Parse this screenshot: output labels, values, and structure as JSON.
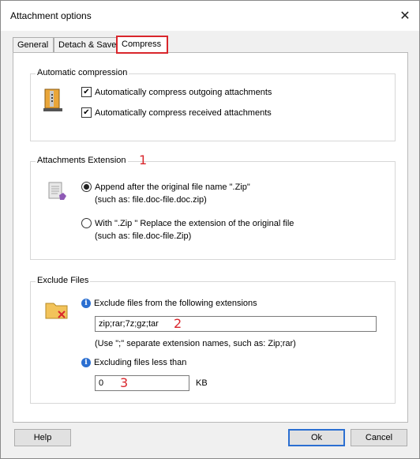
{
  "window": {
    "title": "Attachment options"
  },
  "tabs": [
    {
      "label": "General"
    },
    {
      "label": "Detach & Save"
    },
    {
      "label": "Compress"
    }
  ],
  "auto_compression": {
    "title": "Automatic compression",
    "outgoing_label": "Automatically compress outgoing attachments",
    "outgoing_checked": true,
    "received_label": "Automatically compress received attachments",
    "received_checked": true
  },
  "extension": {
    "title": "Attachments Extension",
    "marker": "1",
    "option1_label": "Append after the original file name \".Zip\"",
    "option1_example": "(such as: file.doc-file.doc.zip)",
    "option2_label": "With \".Zip \" Replace the extension of the original file",
    "option2_example": "(such as: file.doc-file.Zip)",
    "selected": 1
  },
  "exclude": {
    "title": "Exclude Files",
    "ext_label": "Exclude files from the following extensions",
    "ext_value": "zip;rar;7z;gz;tar",
    "ext_marker": "2",
    "ext_hint": "(Use \";\" separate extension names, such as: Zip;rar)",
    "size_label": "Excluding files less than",
    "size_value": "0",
    "size_marker": "3",
    "size_unit": "KB"
  },
  "buttons": {
    "help": "Help",
    "ok": "Ok",
    "cancel": "Cancel"
  },
  "colors": {
    "accent_red": "#d9262c",
    "focus_blue": "#2b6fd1"
  }
}
